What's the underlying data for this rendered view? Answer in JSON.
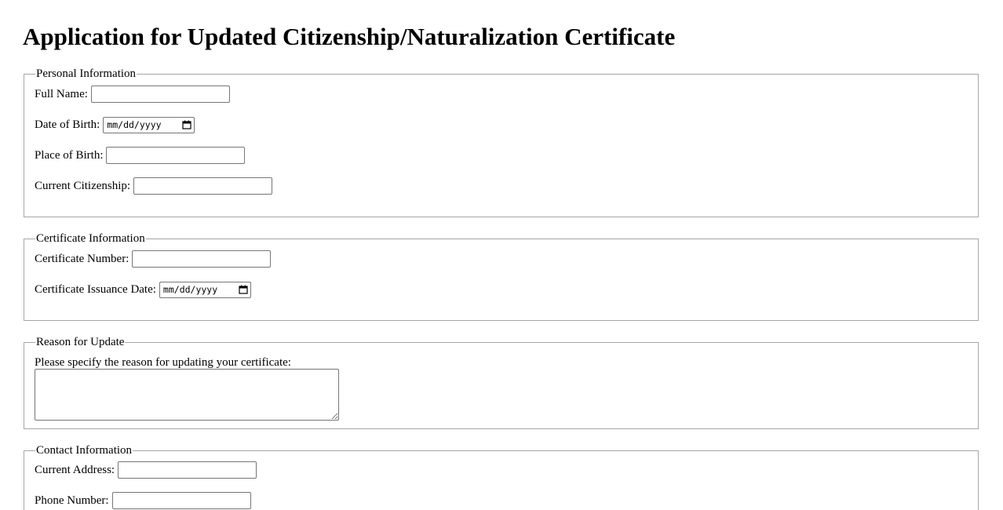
{
  "title": "Application for Updated Citizenship/Naturalization Certificate",
  "sections": {
    "personal": {
      "legend": "Personal Information",
      "full_name": {
        "label": "Full Name:",
        "value": ""
      },
      "dob": {
        "label": "Date of Birth:",
        "value": "mm/dd/yyyy"
      },
      "place_of_birth": {
        "label": "Place of Birth:",
        "value": ""
      },
      "citizenship": {
        "label": "Current Citizenship:",
        "value": ""
      }
    },
    "certificate": {
      "legend": "Certificate Information",
      "number": {
        "label": "Certificate Number:",
        "value": ""
      },
      "issuance_date": {
        "label": "Certificate Issuance Date:",
        "value": "mm/dd/yyyy"
      }
    },
    "reason": {
      "legend": "Reason for Update",
      "prompt": "Please specify the reason for updating your certificate:",
      "value": ""
    },
    "contact": {
      "legend": "Contact Information",
      "address": {
        "label": "Current Address:",
        "value": ""
      },
      "phone": {
        "label": "Phone Number:",
        "value": ""
      }
    }
  },
  "icons": {
    "date_picker": "calendar-icon"
  }
}
